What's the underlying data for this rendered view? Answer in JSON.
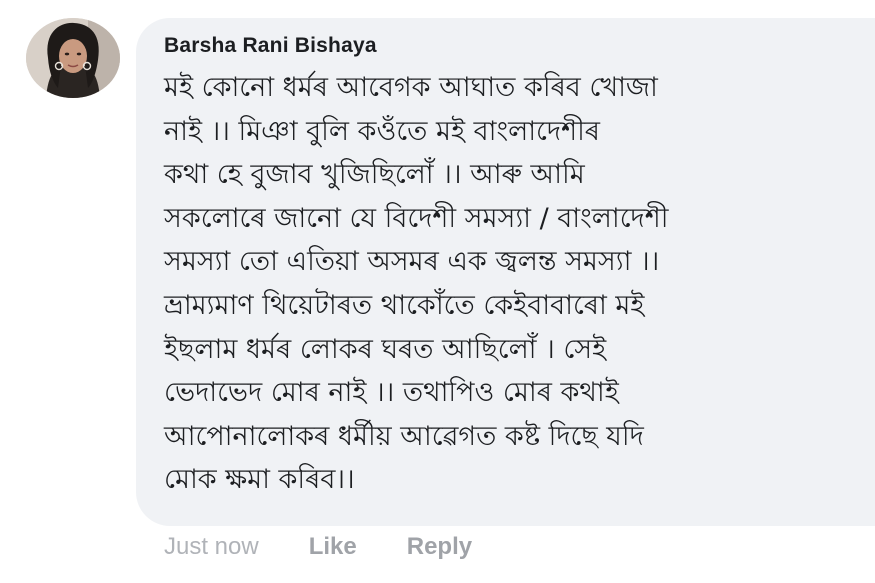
{
  "comment": {
    "author": "Barsha Rani Bishaya",
    "lines": [
      "মই কোনো ধৰ্মৰ আবেগক আঘাত কৰিব খোজা",
      "নাই ।। মিঞা  বুলি কওঁতে মই বাংলাদেশীৰ",
      "কথা হে বুজাব খুজিছিলোঁ ।। আৰু আমি",
      "সকলোৰে জানো যে বিদেশী সমস্যা / বাংলাদেশী",
      "সমস্যা তো এতিয়া অসমৰ এক জ্বলন্ত সমস্যা ।।",
      "ভ্ৰাম্যমাণ থিয়েটাৰত থাকোঁতে কেইবাবাৰো মই",
      "ইছলাম ধৰ্মৰ লোকৰ ঘৰত আছিলোঁ । সেই",
      "ভেদাভেদ মোৰ নাই ।। তথাপিও মোৰ কথাই",
      "আপোনালোকৰ ধৰ্মীয় আৱেগত কষ্ট দিছে যদি",
      "মোক ক্ষমা কৰিব।।"
    ],
    "timestamp": "Just now",
    "like_label": "Like",
    "reply_label": "Reply"
  },
  "colors": {
    "bubble_background": "#f0f2f5",
    "text": "#1c1e21",
    "meta_text": "#a0a3a8"
  }
}
